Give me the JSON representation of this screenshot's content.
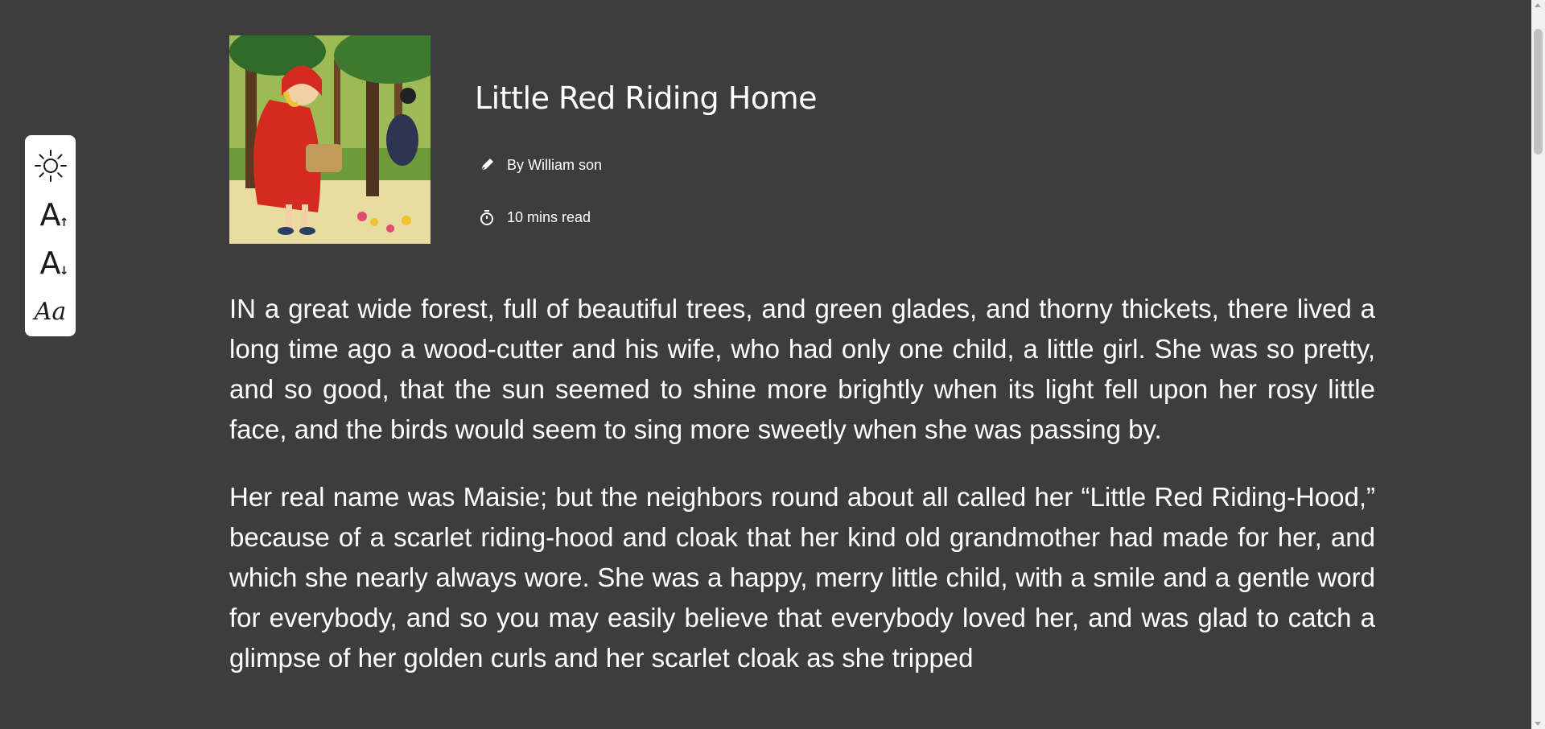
{
  "toolbar": {
    "items": [
      {
        "name": "brightness-icon",
        "glyph": ""
      },
      {
        "name": "increase-font-icon",
        "glyph": "A",
        "arrow": "↑"
      },
      {
        "name": "decrease-font-icon",
        "glyph": "A",
        "arrow": "↓"
      },
      {
        "name": "font-family-icon",
        "glyph": "Aa"
      }
    ]
  },
  "story": {
    "title": "Little Red Riding Home",
    "author": "By William son",
    "read_time": "10 mins read",
    "cover_icon": "cover-illustration",
    "paragraphs": [
      "IN a great wide forest, full of beautiful trees, and green glades, and thorny thickets, there lived a long time ago a wood-cutter and his wife, who had only one child, a little girl. She was so pretty, and so good, that the sun seemed to shine more brightly when its light fell upon her rosy little face, and the birds would seem to sing more sweetly when she was passing by.",
      "Her real name was Maisie; but the neighbors round about all called her “Little Red Riding-Hood,” because of a scarlet riding-hood and cloak that her kind old grandmother had made for her, and which she nearly always wore. She was a happy, merry little child, with a smile and a gentle word for everybody, and so you may easily believe that everybody loved her, and was glad to catch a glimpse of her golden curls and her scarlet cloak as she tripped"
    ]
  },
  "colors": {
    "background": "#3d3d3d",
    "toolbar": "#ffffff",
    "text": "#ffffff"
  }
}
